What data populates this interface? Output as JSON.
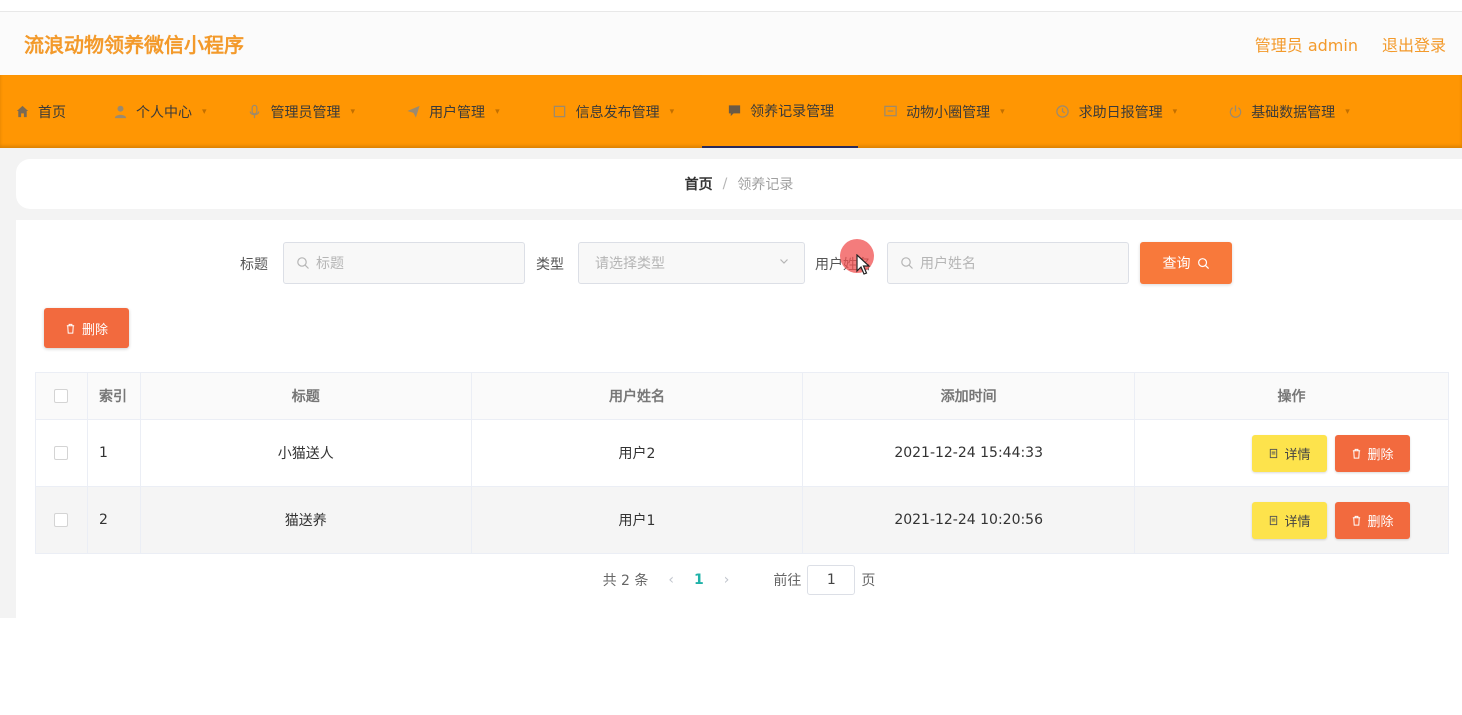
{
  "app": {
    "title": "流浪动物领养微信小程序"
  },
  "header": {
    "user_label": "管理员 admin",
    "logout_label": "退出登录"
  },
  "nav": {
    "items": [
      {
        "label": "首页",
        "icon": "home-icon",
        "has_sub": false
      },
      {
        "label": "个人中心",
        "icon": "user-icon",
        "has_sub": true
      },
      {
        "label": "管理员管理",
        "icon": "mic-icon",
        "has_sub": true
      },
      {
        "label": "用户管理",
        "icon": "send-icon",
        "has_sub": true
      },
      {
        "label": "信息发布管理",
        "icon": "square-icon",
        "has_sub": true
      },
      {
        "label": "领养记录管理",
        "icon": "chat-icon",
        "has_sub": true,
        "active": true
      },
      {
        "label": "动物小圈管理",
        "icon": "message-icon",
        "has_sub": true
      },
      {
        "label": "求助日报管理",
        "icon": "clock-icon",
        "has_sub": true
      },
      {
        "label": "基础数据管理",
        "icon": "power-icon",
        "has_sub": true
      }
    ]
  },
  "breadcrumb": {
    "home": "首页",
    "separator": "/",
    "current": "领养记录"
  },
  "search": {
    "title_label": "标题",
    "title_placeholder": "标题",
    "type_label": "类型",
    "type_placeholder": "请选择类型",
    "username_label": "用户姓名",
    "username_placeholder": "用户姓名",
    "query_button": "查询"
  },
  "actions": {
    "delete_label": "删除"
  },
  "table": {
    "columns": [
      "索引",
      "标题",
      "用户姓名",
      "添加时间",
      "操作"
    ],
    "rows": [
      {
        "index": "1",
        "title": "小猫送人",
        "username": "用户2",
        "time": "2021-12-24 15:44:33"
      },
      {
        "index": "2",
        "title": "猫送养",
        "username": "用户1",
        "time": "2021-12-24 10:20:56"
      }
    ],
    "detail_label": "详情",
    "delete_label": "删除"
  },
  "pagination": {
    "total_text": "共 2 条",
    "prev": "‹",
    "current_page": "1",
    "next": "›",
    "goto_label": "前往",
    "goto_value": "1",
    "page_suffix": "页"
  },
  "colors": {
    "brand": "#ff9603",
    "title": "#f39a2b",
    "danger": "#f26a3e",
    "warning": "#fde34c",
    "active_page": "#20b2a8"
  }
}
